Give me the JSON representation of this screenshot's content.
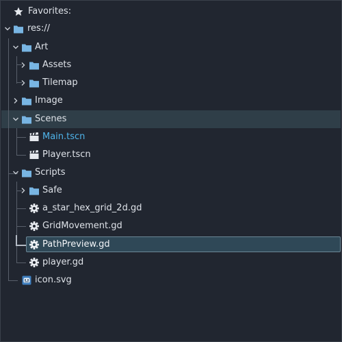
{
  "favorites": {
    "label": "Favorites:"
  },
  "tree": {
    "root": "res://",
    "art": "Art",
    "assets": "Assets",
    "tilemap": "Tilemap",
    "image": "Image",
    "scenes": "Scenes",
    "main_tscn": "Main.tscn",
    "player_tscn": "Player.tscn",
    "scripts": "Scripts",
    "safe": "Safe",
    "a_star": "a_star_hex_grid_2d.gd",
    "grid_movement": "GridMovement.gd",
    "path_preview": "PathPreview.gd",
    "player_gd": "player.gd",
    "icon_svg": "icon.svg"
  },
  "colors": {
    "background": "#212630",
    "folder": "#78b5e3",
    "text": "#dee2e8",
    "active_file": "#4fb4ea",
    "selected_bg": "#2f4857",
    "parent_highlight": "#2f3e48"
  }
}
